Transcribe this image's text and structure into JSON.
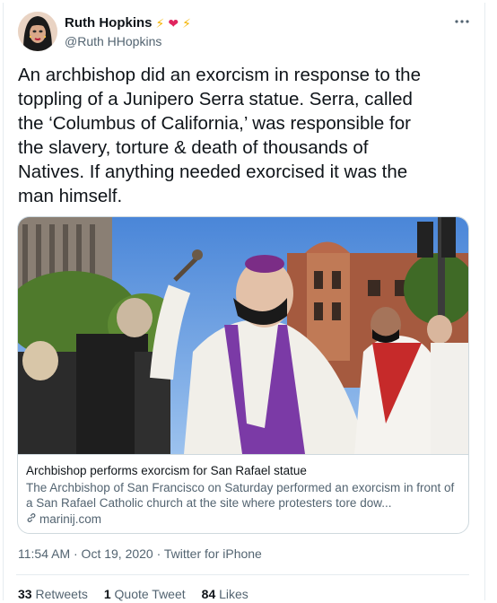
{
  "author": {
    "display_name": "Ruth Hopkins",
    "emoji": [
      "⚡",
      "❤",
      "⚡"
    ],
    "handle": "@Ruth HHopkins"
  },
  "more_icon": "more-horizontal-icon",
  "tweet": {
    "text": "An archbishop did an exorcism in response to the\ntoppling of a Junipero Serra statue. Serra, called\nthe ‘Columbus of California,’ was responsible for\nthe slavery, torture & death of thousands of\nNatives. If anything needed exorcised it was the\nman himself."
  },
  "card": {
    "title": "Archbishop performs exorcism for San Rafael statue",
    "description": "The Archbishop of San Francisco on Saturday performed an exorcism in front of a San Rafael Catholic church at the site where protesters tore dow...",
    "link": "marinij.com",
    "link_icon": "link-icon"
  },
  "meta": "11:54 AM · Oct 19, 2020 · Twitter for iPhone",
  "stats": {
    "retweets_count": "33",
    "retweets_label": "Retweets",
    "quotes_count": "1",
    "quotes_label": "Quote Tweet",
    "likes_count": "84",
    "likes_label": "Likes"
  },
  "colors": {
    "text": "#0f1419",
    "secondary": "#536471",
    "border": "#cfd9de",
    "lightning": "#f4b400",
    "heart": "#e0245e"
  }
}
